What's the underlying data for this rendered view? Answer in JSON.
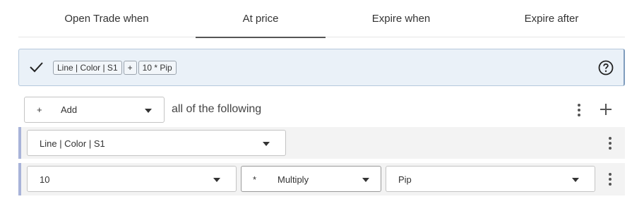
{
  "tabs": [
    {
      "label": "Open Trade when",
      "active": false
    },
    {
      "label": "At price",
      "active": true
    },
    {
      "label": "Expire when",
      "active": false
    },
    {
      "label": "Expire after",
      "active": false
    }
  ],
  "summary": {
    "chips": [
      "Line | Color | S1",
      "+",
      "10 * Pip"
    ],
    "icons": {
      "check": "check-icon",
      "help": "help-icon"
    },
    "colors": {
      "background": "#eaf1f8",
      "border": "#b5c8dc"
    }
  },
  "condition": {
    "add_symbol": "+",
    "add_label": "Add",
    "text": "all of the following"
  },
  "operands": {
    "line_select": "Line | Color | S1",
    "number_value": "10",
    "operator_symbol": "*",
    "operator_label": "Multiply",
    "unit_select": "Pip"
  },
  "colors": {
    "accent_left_border": "#a8b3d9",
    "row_background": "#f3f3f3"
  }
}
